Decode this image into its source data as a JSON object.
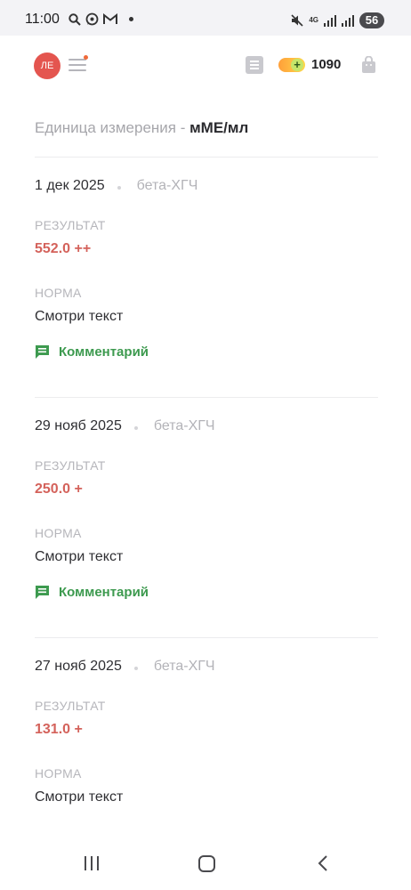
{
  "status_bar": {
    "time": "11:00",
    "network": "4G",
    "battery": "56",
    "icons": [
      "search-icon",
      "whatsapp-icon",
      "gmail-icon",
      "notification-dot",
      "mute-icon",
      "network-4g-icon",
      "signal-icon",
      "signal-icon-2",
      "battery-icon"
    ]
  },
  "header": {
    "avatar_initials": "ЛЕ",
    "avatar_color": "#e4554f",
    "coins": "1090",
    "icons": [
      "menu-icon",
      "list-icon",
      "coin-add-icon",
      "bag-icon"
    ]
  },
  "unit": {
    "prefix": "Единица измерения - ",
    "value": "мМЕ/мл"
  },
  "entries": [
    {
      "date": "1 дек 2025",
      "analyte": "бета-ХГЧ",
      "result_label": "РЕЗУЛЬТАТ",
      "result": "552.0 ++",
      "norm_label": "НОРМА",
      "norm": "Смотри текст",
      "comment": "Комментарий"
    },
    {
      "date": "29 нояб 2025",
      "analyte": "бета-ХГЧ",
      "result_label": "РЕЗУЛЬТАТ",
      "result": "250.0 +",
      "norm_label": "НОРМА",
      "norm": "Смотри текст",
      "comment": "Комментарий"
    },
    {
      "date": "27 нояб 2025",
      "analyte": "бета-ХГЧ",
      "result_label": "РЕЗУЛЬТАТ",
      "result": "131.0 +",
      "norm_label": "НОРМА",
      "norm": "Смотри текст"
    }
  ],
  "colors": {
    "result": "#d4625b",
    "comment": "#3d9a4f",
    "muted": "#b3b3b8"
  },
  "nav": {
    "icons": [
      "recent-apps-icon",
      "home-icon",
      "back-icon"
    ]
  }
}
